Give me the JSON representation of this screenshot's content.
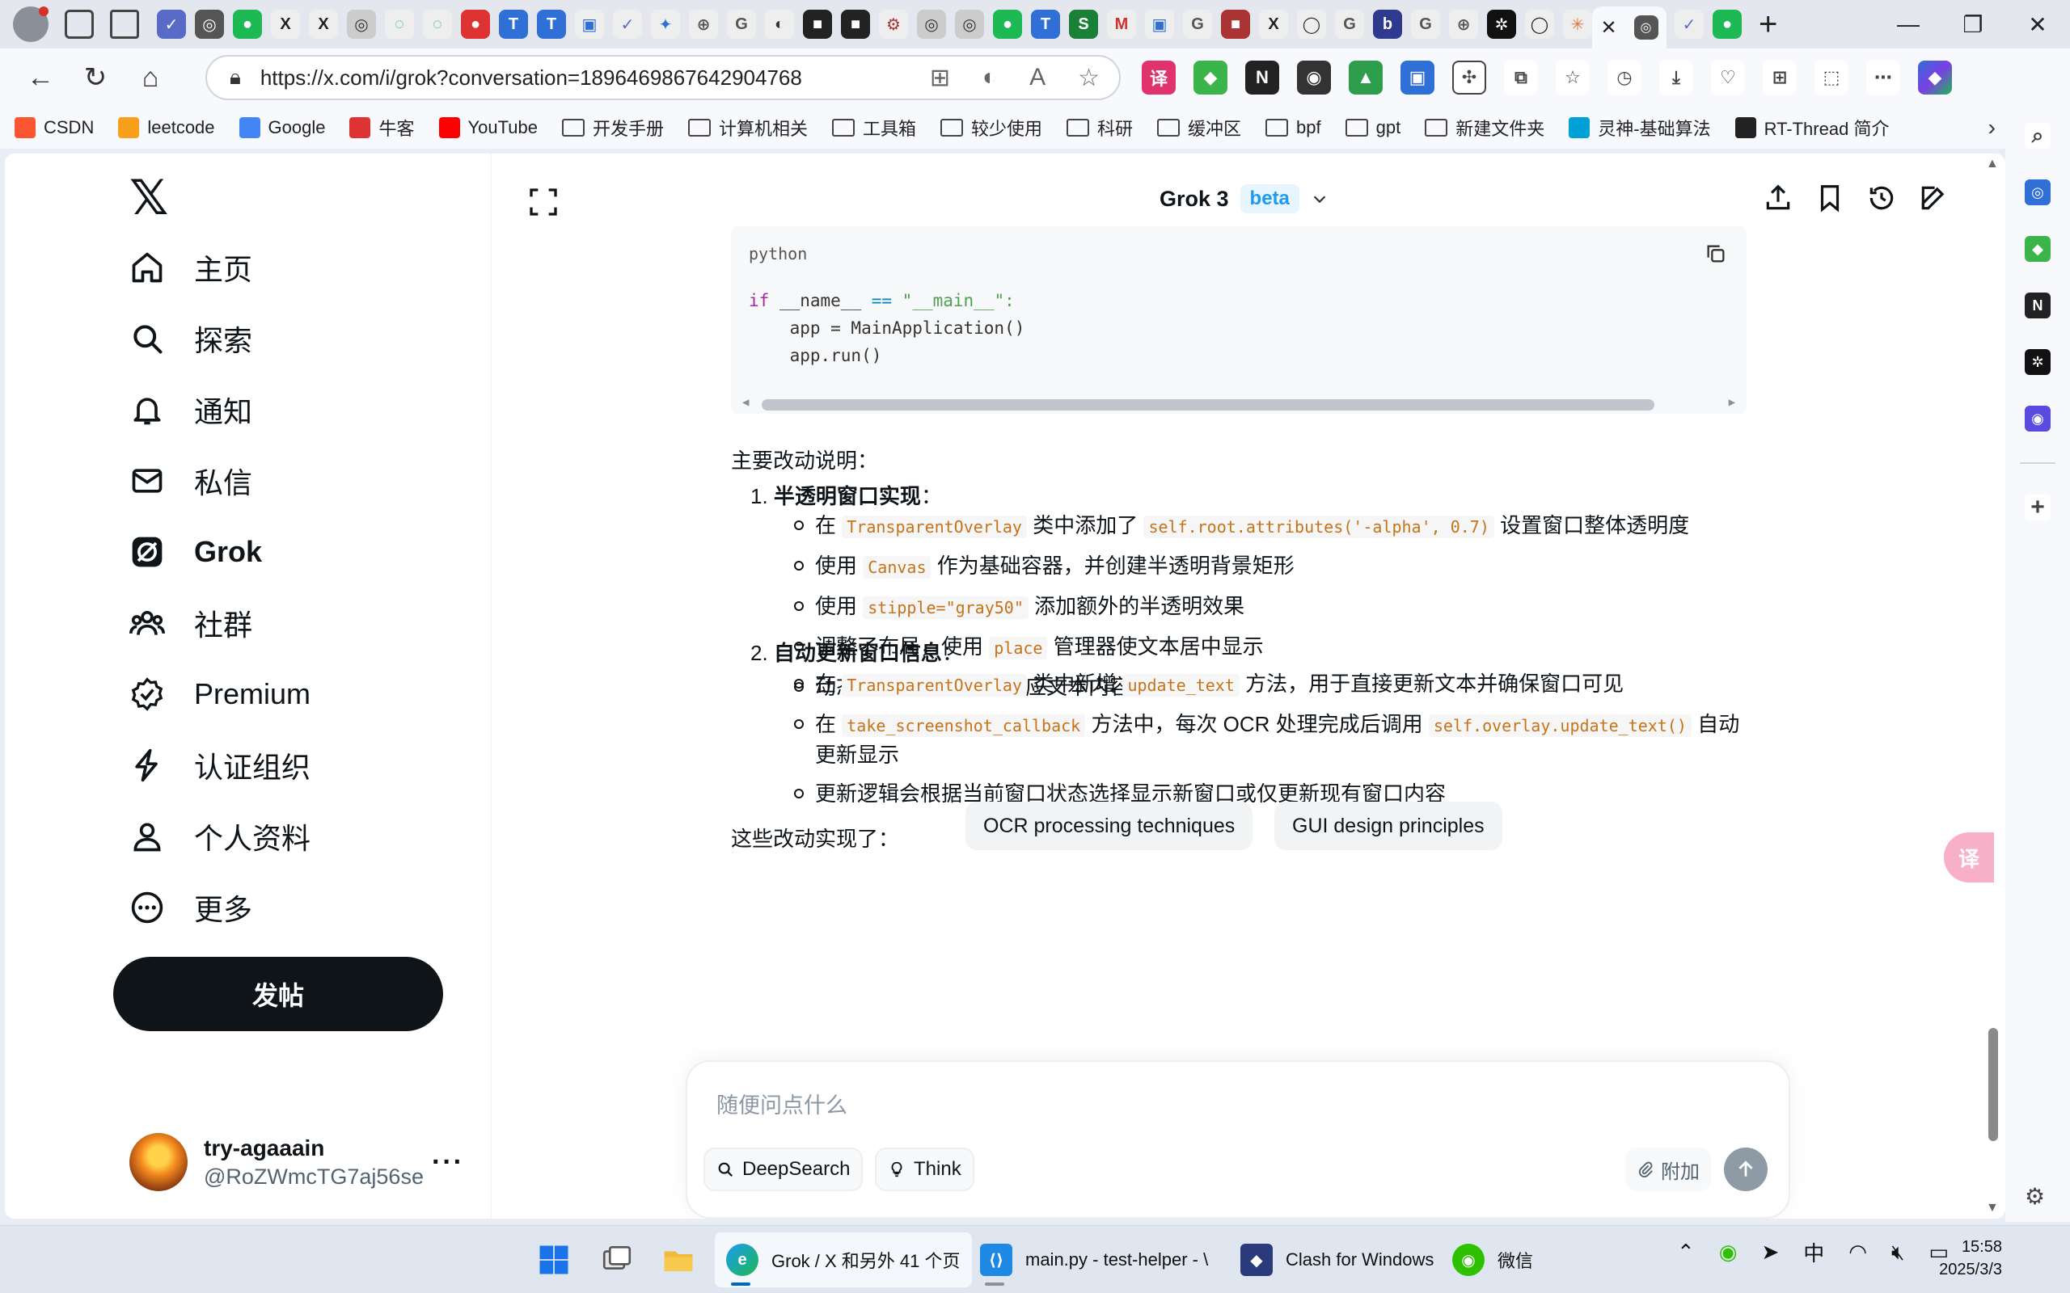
{
  "browser": {
    "active_tab_close": "✕",
    "new_tab": "+",
    "url": "https://x.com/i/grok?conversation=1896469867642904768",
    "bookmarks": [
      {
        "label": "CSDN",
        "icon": "csdn-icon",
        "color": "#fc5531"
      },
      {
        "label": "leetcode",
        "icon": "leetcode-icon",
        "color": "#f89f1b"
      },
      {
        "label": "Google",
        "icon": "google-icon",
        "color": "#4285f4"
      },
      {
        "label": "牛客",
        "icon": "nowcoder-icon",
        "color": "#d33"
      },
      {
        "label": "YouTube",
        "icon": "youtube-icon",
        "color": "#ff0000"
      },
      {
        "label": "开发手册",
        "icon": "folder-icon"
      },
      {
        "label": "计算机相关",
        "icon": "folder-icon"
      },
      {
        "label": "工具箱",
        "icon": "folder-icon"
      },
      {
        "label": "较少使用",
        "icon": "folder-icon"
      },
      {
        "label": "科研",
        "icon": "folder-icon"
      },
      {
        "label": "缓冲区",
        "icon": "folder-icon"
      },
      {
        "label": "bpf",
        "icon": "folder-icon"
      },
      {
        "label": "gpt",
        "icon": "folder-icon"
      },
      {
        "label": "新建文件夹",
        "icon": "folder-icon"
      },
      {
        "label": "灵神-基础算法",
        "icon": "bilibili-icon",
        "color": "#00a1d6"
      },
      {
        "label": "RT-Thread 简介",
        "icon": "book-icon",
        "color": "#222"
      }
    ]
  },
  "nav": {
    "items": [
      {
        "label": "主页",
        "icon": "home-icon"
      },
      {
        "label": "探索",
        "icon": "search-icon"
      },
      {
        "label": "通知",
        "icon": "bell-icon"
      },
      {
        "label": "私信",
        "icon": "mail-icon"
      },
      {
        "label": "Grok",
        "icon": "grok-icon"
      },
      {
        "label": "社群",
        "icon": "communities-icon"
      },
      {
        "label": "Premium",
        "icon": "premium-icon"
      },
      {
        "label": "认证组织",
        "icon": "lightning-icon"
      },
      {
        "label": "个人资料",
        "icon": "profile-icon"
      },
      {
        "label": "更多",
        "icon": "more-circle-icon"
      }
    ],
    "post_button": "发帖",
    "account": {
      "name": "try-agaaain",
      "handle": "@RoZWmcTG7aj56se"
    }
  },
  "grok": {
    "title": "Grok 3",
    "badge": "beta"
  },
  "code": {
    "language": "python",
    "line_if": "if",
    "line_name": " __name__ ",
    "line_eq": "==",
    "line_str": " \"__main__\":",
    "line2": "    app = MainApplication()",
    "line3": "    app.run()"
  },
  "answer": {
    "intro": "主要改动说明：",
    "section1_num": "1.",
    "section1_title": "半透明窗口实现",
    "colon": "：",
    "s1": [
      {
        "pre": "在 ",
        "code1": "TransparentOverlay",
        "mid": " 类中添加了 ",
        "code2": "self.root.attributes('-alpha', 0.7)",
        "post": " 设置窗口整体透明度"
      },
      {
        "pre": "使用 ",
        "code1": "Canvas",
        "post": " 作为基础容器，并创建半透明背景矩形"
      },
      {
        "pre": "使用 ",
        "code1": "stipple=\"gray50\"",
        "post": " 添加额外的半透明效果"
      },
      {
        "pre": "调整了布局，使用 ",
        "code1": "place",
        "post": " 管理器使文本居中显示"
      },
      {
        "pre": "动态调整窗口大小以适应文本内容"
      }
    ],
    "section2_num": "2.",
    "section2_title": "自动更新窗口信息",
    "s2": [
      {
        "pre": "在 ",
        "code1": "TransparentOverlay",
        "mid": " 类中新增 ",
        "code2": "update_text",
        "post": " 方法，用于直接更新文本并确保窗口可见"
      },
      {
        "pre": "在 ",
        "code1": "take_screenshot_callback",
        "mid": " 方法中，每次 OCR 处理完成后调用 ",
        "code2": "self.overlay.update_text()",
        "post": " 自动",
        "post2": "更新显示"
      },
      {
        "pre": "更新逻辑会根据当前窗口状态选择显示新窗口或仅更新现有窗口内容"
      }
    ],
    "tail": "这些改动实现了："
  },
  "suggestions": [
    "OCR processing techniques",
    "GUI design principles"
  ],
  "composer": {
    "placeholder": "随便问点什么",
    "deepsearch": "DeepSearch",
    "think": "Think",
    "attach": "附加"
  },
  "taskbar": {
    "apps": [
      {
        "label": "Grok / X 和另外 41 个页",
        "icon": "edge-icon"
      },
      {
        "label": "main.py - test-helper - \\",
        "icon": "vscode-icon"
      },
      {
        "label": "Clash for Windows",
        "icon": "clash-icon"
      },
      {
        "label": "微信",
        "icon": "wechat-icon"
      }
    ],
    "ime": "中",
    "time": "15:58",
    "date": "2025/3/3"
  },
  "colors": {
    "accent": "#1d9bf0",
    "inline_code": "#c7731a",
    "post_button_bg": "#0f1419"
  }
}
